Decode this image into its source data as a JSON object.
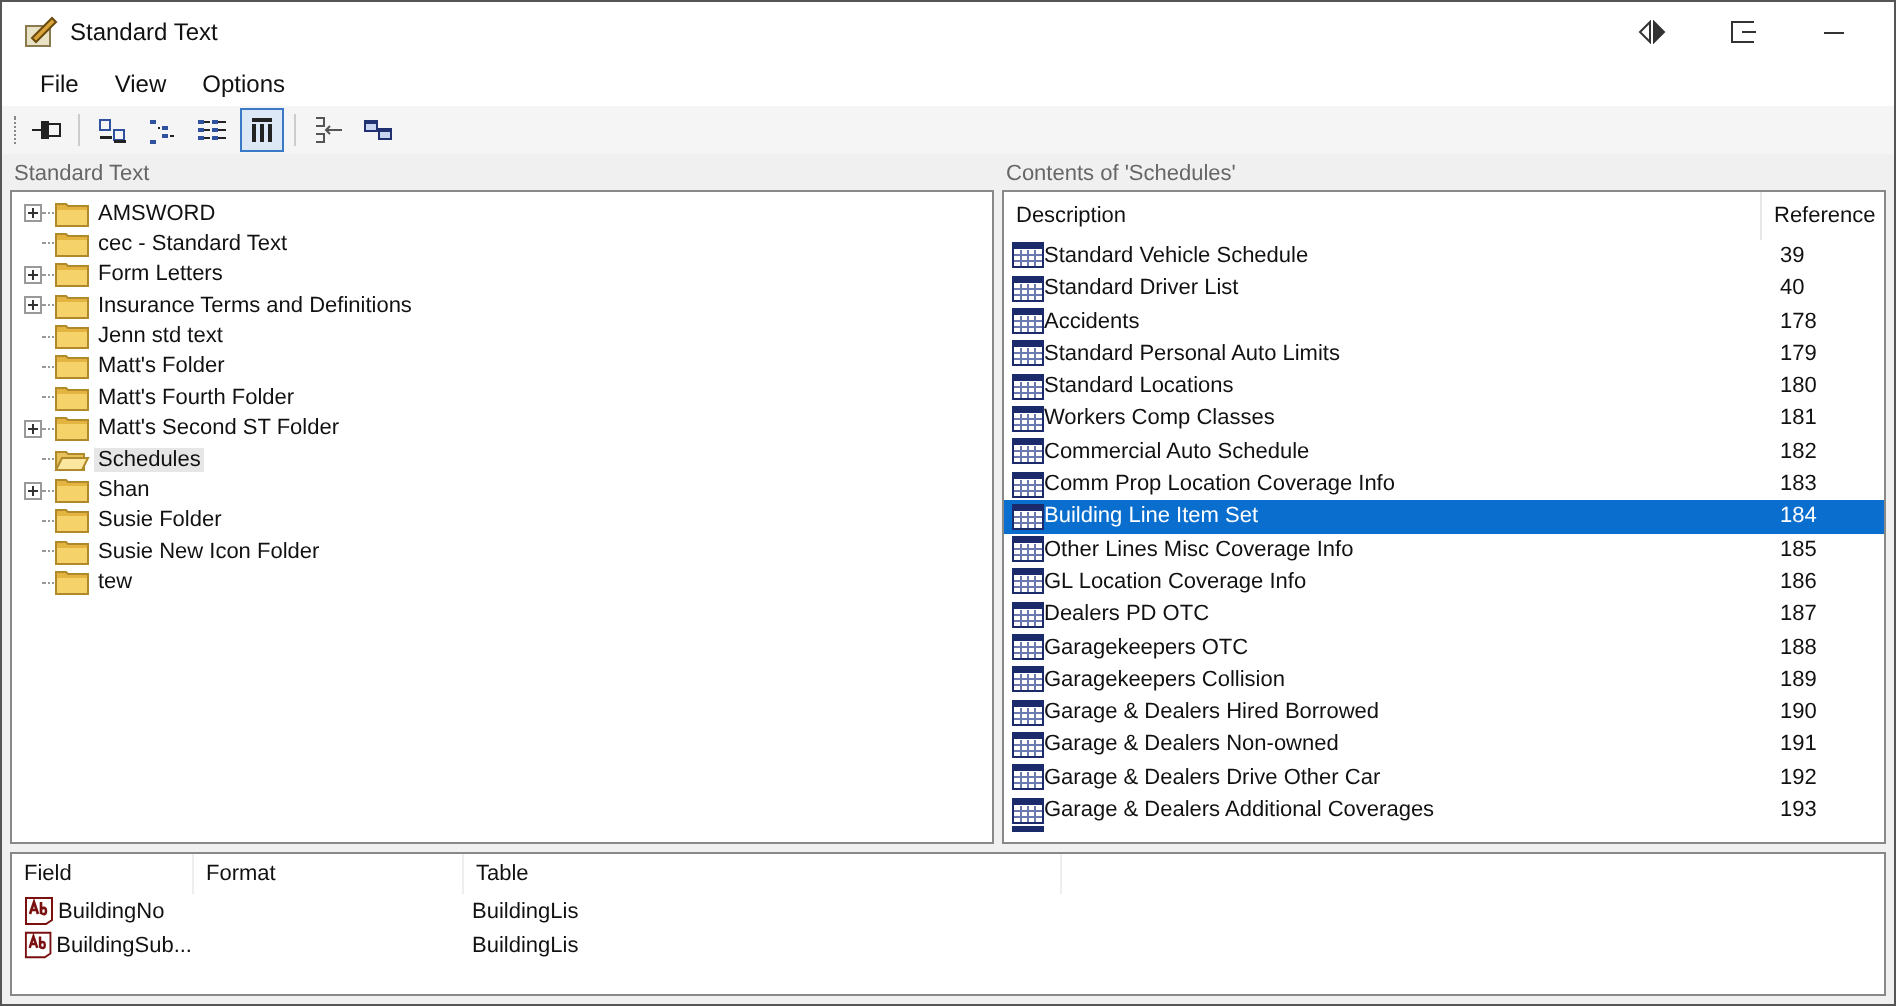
{
  "window": {
    "title": "Standard Text"
  },
  "menu": [
    "File",
    "View",
    "Options"
  ],
  "toolbar": [
    {
      "kind": "pin",
      "selected": false
    },
    {
      "kind": "sep"
    },
    {
      "kind": "rename",
      "selected": false
    },
    {
      "kind": "tree",
      "selected": false
    },
    {
      "kind": "list",
      "selected": false
    },
    {
      "kind": "details",
      "selected": true
    },
    {
      "kind": "sep"
    },
    {
      "kind": "collapse",
      "selected": false
    },
    {
      "kind": "windows",
      "selected": false
    }
  ],
  "tree": {
    "title": "Standard Text",
    "items": [
      {
        "label": "AMSWORD",
        "expandable": true,
        "selected": false
      },
      {
        "label": "cec - Standard Text",
        "expandable": false,
        "selected": false
      },
      {
        "label": "Form Letters",
        "expandable": true,
        "selected": false
      },
      {
        "label": "Insurance Terms and Definitions",
        "expandable": true,
        "selected": false
      },
      {
        "label": "Jenn std text",
        "expandable": false,
        "selected": false
      },
      {
        "label": "Matt's Folder",
        "expandable": false,
        "selected": false
      },
      {
        "label": "Matt's Fourth Folder",
        "expandable": false,
        "selected": false
      },
      {
        "label": "Matt's Second ST Folder",
        "expandable": true,
        "selected": false
      },
      {
        "label": "Schedules",
        "expandable": false,
        "selected": true
      },
      {
        "label": "Shan",
        "expandable": true,
        "selected": false
      },
      {
        "label": "Susie Folder",
        "expandable": false,
        "selected": false
      },
      {
        "label": "Susie New Icon Folder",
        "expandable": false,
        "selected": false
      },
      {
        "label": "tew",
        "expandable": false,
        "selected": false
      }
    ]
  },
  "contents": {
    "title": "Contents of 'Schedules'",
    "columns": [
      "Description",
      "Reference"
    ],
    "rows": [
      {
        "description": "Standard Vehicle Schedule",
        "reference": "39",
        "selected": false
      },
      {
        "description": "Standard Driver List",
        "reference": "40",
        "selected": false
      },
      {
        "description": "Accidents",
        "reference": "178",
        "selected": false
      },
      {
        "description": "Standard Personal Auto Limits",
        "reference": "179",
        "selected": false
      },
      {
        "description": "Standard Locations",
        "reference": "180",
        "selected": false
      },
      {
        "description": "Workers Comp Classes",
        "reference": "181",
        "selected": false
      },
      {
        "description": "Commercial Auto Schedule",
        "reference": "182",
        "selected": false
      },
      {
        "description": "Comm Prop Location Coverage Info",
        "reference": "183",
        "selected": false
      },
      {
        "description": "Building Line Item Set",
        "reference": "184",
        "selected": true
      },
      {
        "description": "Other Lines Misc Coverage Info",
        "reference": "185",
        "selected": false
      },
      {
        "description": "GL Location Coverage Info",
        "reference": "186",
        "selected": false
      },
      {
        "description": "Dealers PD OTC",
        "reference": "187",
        "selected": false
      },
      {
        "description": "Garagekeepers OTC",
        "reference": "188",
        "selected": false
      },
      {
        "description": "Garagekeepers Collision",
        "reference": "189",
        "selected": false
      },
      {
        "description": "Garage & Dealers Hired Borrowed",
        "reference": "190",
        "selected": false
      },
      {
        "description": "Garage & Dealers Non-owned",
        "reference": "191",
        "selected": false
      },
      {
        "description": "Garage & Dealers Drive Other Car",
        "reference": "192",
        "selected": false
      },
      {
        "description": "Garage & Dealers Additional Coverages",
        "reference": "193",
        "selected": false
      }
    ]
  },
  "fields": {
    "columns": [
      "Field",
      "Format",
      "Table"
    ],
    "rows": [
      {
        "field": "BuildingNo",
        "table": "BuildingLis"
      },
      {
        "field": "BuildingSub...",
        "table": "BuildingLis"
      }
    ]
  }
}
